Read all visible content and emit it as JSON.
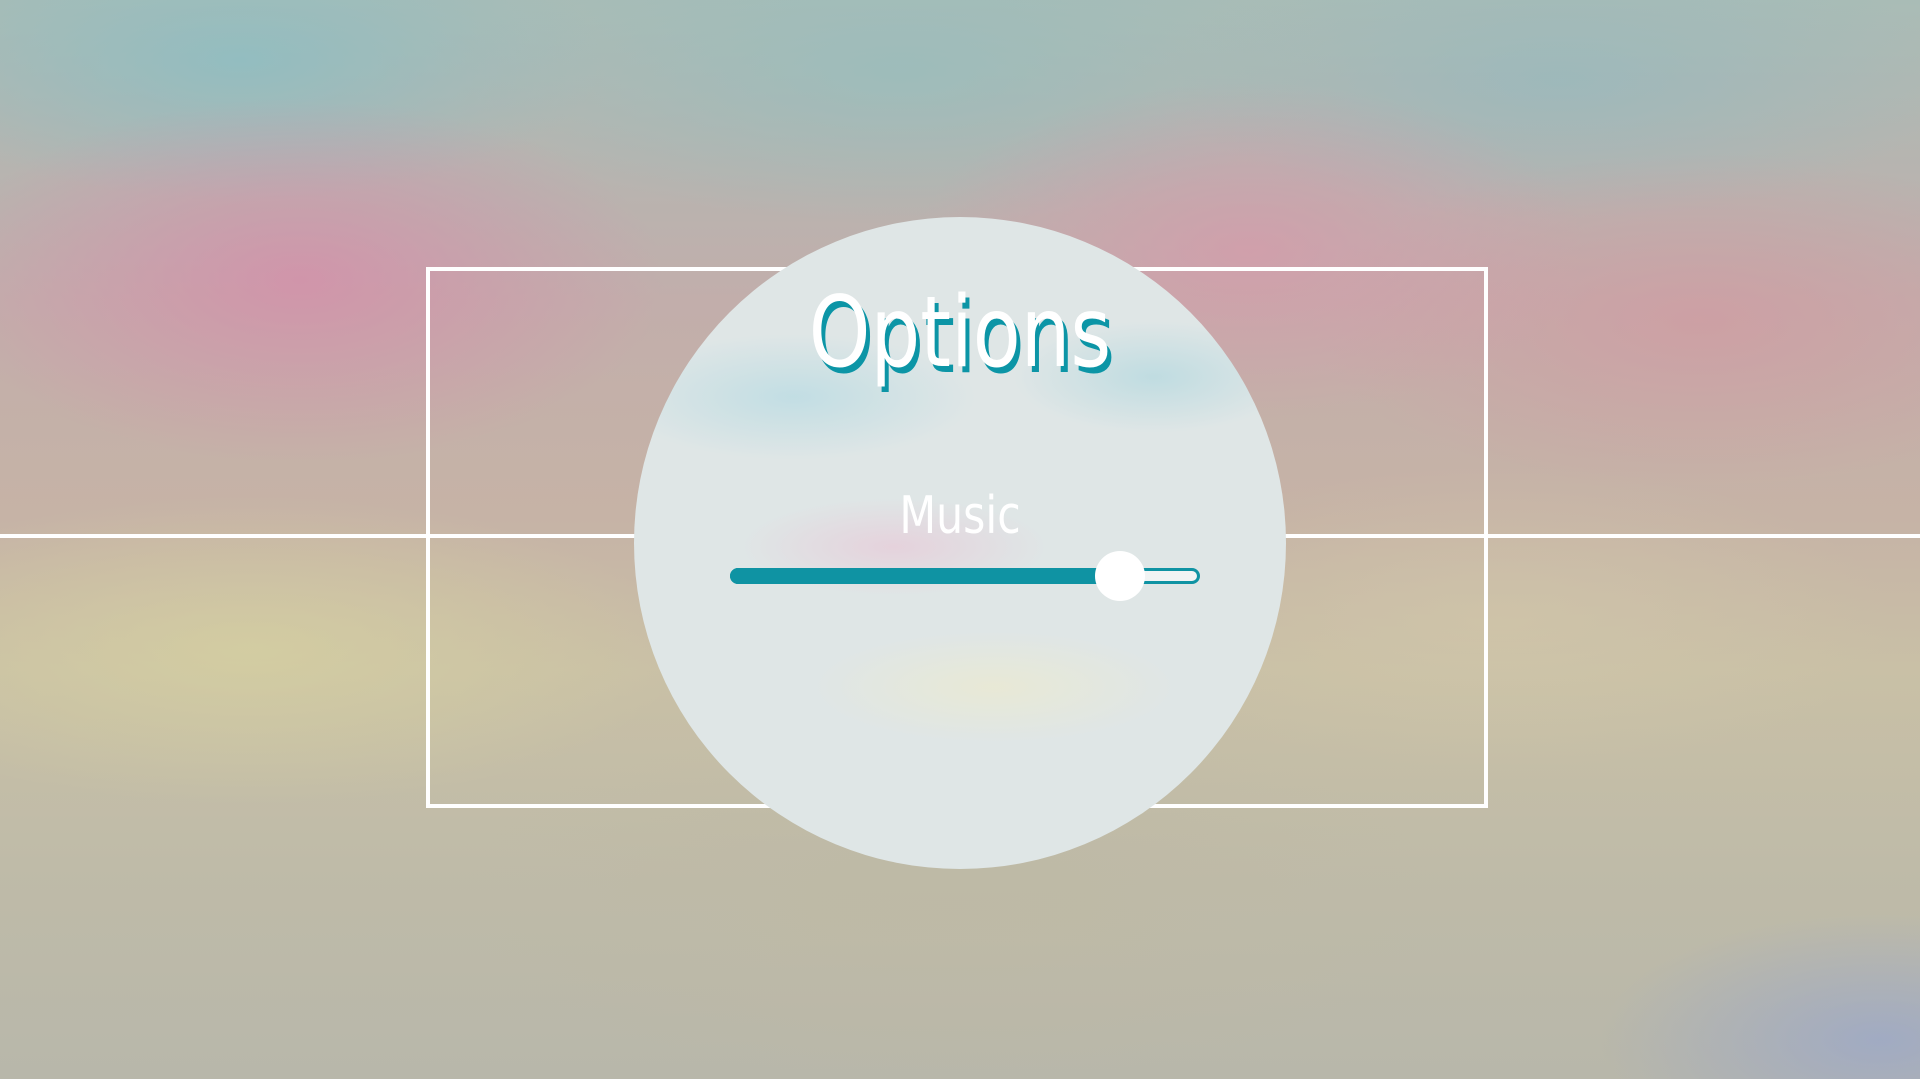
{
  "screen": {
    "title": "Options"
  },
  "settings": {
    "music": {
      "label": "Music",
      "value": 0.83
    }
  },
  "colors": {
    "accent": "#0f93a3",
    "text": "#ffffff",
    "panel": "#dfe6e6"
  }
}
